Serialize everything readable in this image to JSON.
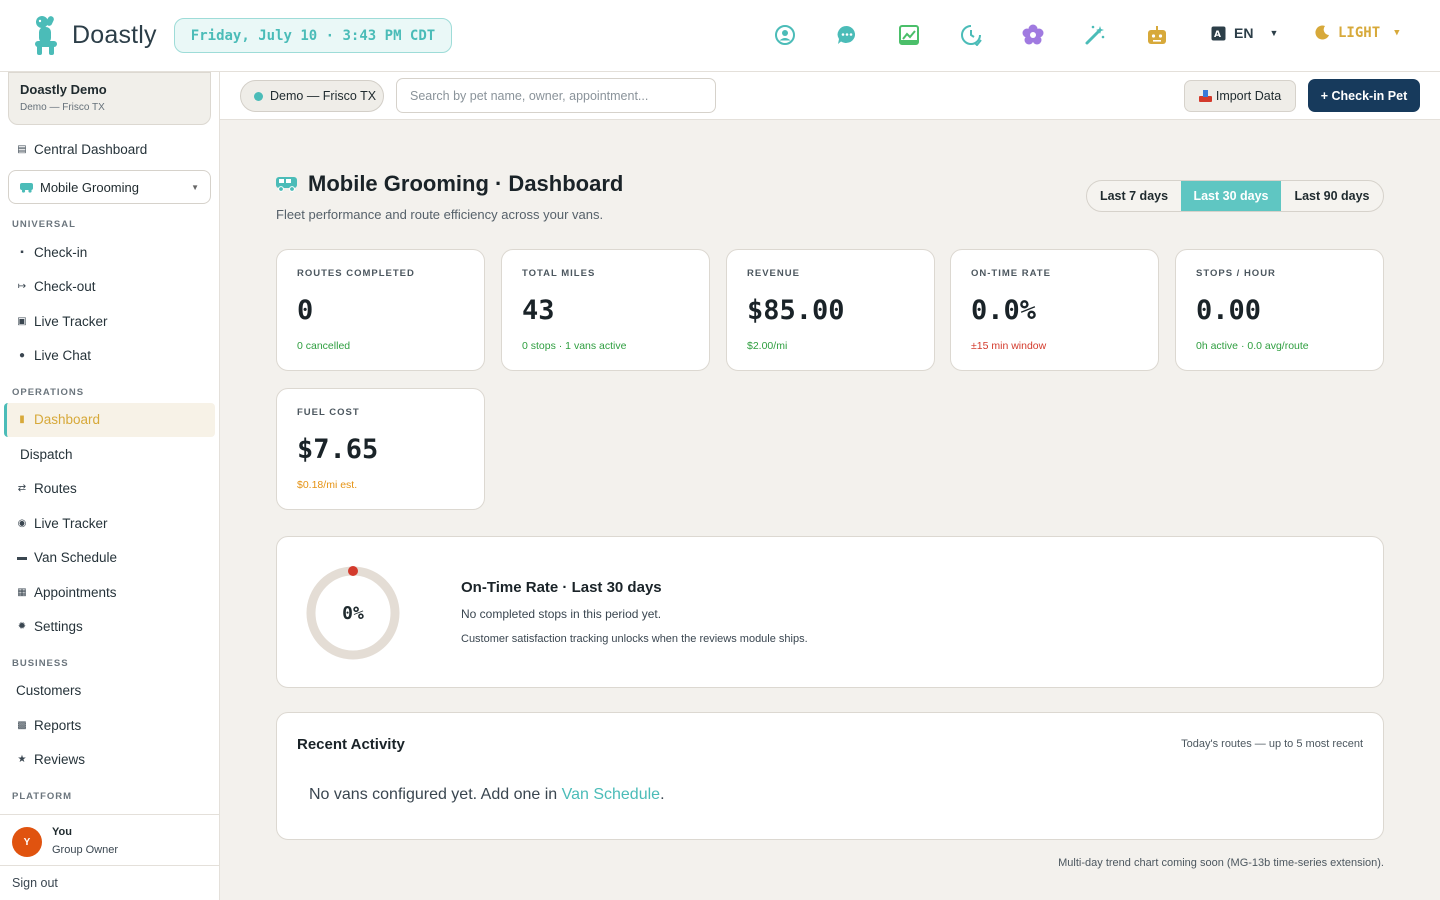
{
  "app": {
    "name": "Doastly",
    "datetime": "Friday, July 10 · 3:43 PM CDT"
  },
  "topbar": {
    "icons": [
      "profile-icon",
      "chat-icon",
      "chart-icon",
      "clock-icon",
      "flower-icon",
      "magic-icon",
      "robot-icon"
    ],
    "lang": "EN",
    "theme": "LIGHT"
  },
  "sidebar": {
    "org_name": "Doastly Demo",
    "org_sub": "Demo — Frisco TX",
    "central": "Central Dashboard",
    "module": "Mobile Grooming",
    "sections": {
      "universal": "UNIVERSAL",
      "operations": "OPERATIONS",
      "business": "BUSINESS",
      "platform": "PLATFORM"
    },
    "universal": [
      "Check-in",
      "Check-out",
      "Live Tracker",
      "Live Chat"
    ],
    "operations": [
      "Dashboard",
      "Dispatch",
      "Routes",
      "Live Tracker",
      "Van Schedule",
      "Appointments",
      "Settings"
    ],
    "business": [
      "Customers",
      "Reports",
      "Reviews"
    ],
    "user": {
      "initial": "Y",
      "name": "You",
      "role": "Group Owner"
    },
    "signout": "Sign out"
  },
  "subheader": {
    "location": "Demo — Frisco TX",
    "search_placeholder": "Search by pet name, owner, appointment...",
    "import": "Import Data",
    "checkin": "+ Check-in Pet"
  },
  "main": {
    "title": "Mobile Grooming · Dashboard",
    "subtitle": "Fleet performance and route efficiency across your vans.",
    "ranges": [
      "Last 7 days",
      "Last 30 days",
      "Last 90 days"
    ],
    "active_range": "Last 30 days",
    "kpis": [
      {
        "label": "ROUTES COMPLETED",
        "value": "0",
        "note": "0 cancelled",
        "note_color": "#2e9e3f"
      },
      {
        "label": "TOTAL MILES",
        "value": "43",
        "note": "0 stops · 1 vans active",
        "note_color": "#2e9e3f"
      },
      {
        "label": "REVENUE",
        "value": "$85.00",
        "note": "$2.00/mi",
        "note_color": "#2e9e3f"
      },
      {
        "label": "ON-TIME RATE",
        "value": "0.0%",
        "note": "±15 min window",
        "note_color": "#d33a2c"
      },
      {
        "label": "STOPS / HOUR",
        "value": "0.00",
        "note": "0h active · 0.0 avg/route",
        "note_color": "#2e9e3f"
      },
      {
        "label": "FUEL COST",
        "value": "$7.65",
        "note": "$0.18/mi est.",
        "note_color": "#e59314"
      }
    ],
    "ontime": {
      "ring_value": "0%",
      "rate": 0,
      "title": "On-Time Rate · Last 30 days",
      "line1": "No completed stops in this period yet.",
      "line2": "Customer satisfaction tracking unlocks when the reviews module ships."
    },
    "activity": {
      "title": "Recent Activity",
      "right": "Today's routes — up to 5 most recent",
      "empty_prefix": "No vans configured yet. Add one in ",
      "empty_link": "Van Schedule",
      "empty_suffix": "."
    },
    "footnote": "Multi-day trend chart coming soon (MG-13b time-series extension)."
  },
  "colors": {
    "accent": "#4bbcb8",
    "navy": "#173a5c",
    "gold": "#d7a93a",
    "ring_bg": "#e4ddd5",
    "ring_dot": "#d33a2c"
  }
}
